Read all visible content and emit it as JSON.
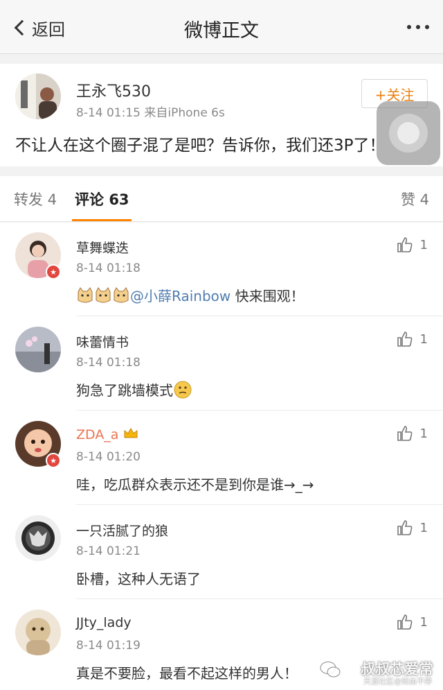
{
  "navbar": {
    "back_label": "返回",
    "title": "微博正文"
  },
  "post": {
    "author": "王永飞530",
    "date": "8-14 01:15",
    "source": "来自iPhone 6s",
    "follow_label": "+关注",
    "text": "不让人在这个圈子混了是吧？告诉你，我们还3P了！"
  },
  "tabs": [
    {
      "label": "转发",
      "count": "4"
    },
    {
      "label": "评论",
      "count": "63"
    },
    {
      "label": "赞",
      "count": "4"
    }
  ],
  "comments": [
    {
      "name": "草舞蝶迭",
      "time": "8-14 01:18",
      "text_mention": "@小薛Rainbow",
      "text": " 快来围观！",
      "likes": "1"
    },
    {
      "name": "味蕾情书",
      "time": "8-14 01:18",
      "text": "狗急了跳墙模式",
      "likes": "1"
    },
    {
      "name": "ZDA_a",
      "time": "8-14 01:20",
      "text": "哇，吃瓜群众表示还不是到你是谁→_→",
      "likes": "1"
    },
    {
      "name": "一只活腻了的狼",
      "time": "8-14 01:21",
      "text": "卧槽，这种人无语了",
      "likes": "1"
    },
    {
      "name": "JJty_lady",
      "time": "8-14 01:19",
      "text": "真是不要脸，最看不起这样的男人！",
      "likes": "1"
    }
  ],
  "watermark": {
    "title": "叔叔芯爱常",
    "subtitle": "天涯社区@知血不停"
  },
  "colors": {
    "accent": "#ff8200",
    "follow": "#ea8010",
    "mention": "#507daf",
    "vip_name": "#eb7350"
  }
}
